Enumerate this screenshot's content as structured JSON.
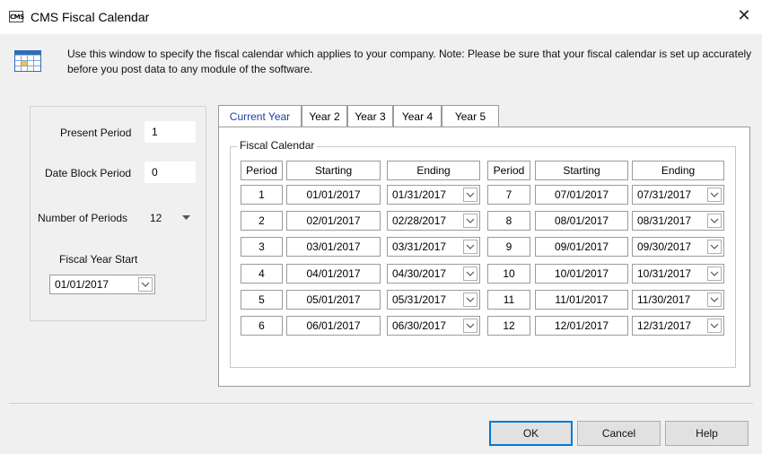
{
  "window": {
    "title": "CMS Fiscal Calendar",
    "app_icon_text": "CMS",
    "close_glyph": "✕"
  },
  "info": {
    "text": "Use this window to specify the fiscal calendar which applies to your company. Note: Please be sure that your fiscal calendar is set up accurately before you post data to any module of the software.",
    "icon": "calendar-grid-icon"
  },
  "left": {
    "present_period_label": "Present Period",
    "present_period_value": "1",
    "date_block_label": "Date Block Period",
    "date_block_value": "0",
    "num_periods_label": "Number of Periods",
    "num_periods_value": "12",
    "fy_start_label": "Fiscal Year Start",
    "fy_start_value": "01/01/2017"
  },
  "tabs": [
    "Current Year",
    "Year 2",
    "Year 3",
    "Year 4",
    "Year 5"
  ],
  "calendar": {
    "legend": "Fiscal Calendar",
    "headers": {
      "period": "Period",
      "starting": "Starting",
      "ending": "Ending"
    },
    "rows": [
      {
        "p1": "1",
        "s1": "01/01/2017",
        "e1": "01/31/2017",
        "p2": "7",
        "s2": "07/01/2017",
        "e2": "07/31/2017"
      },
      {
        "p1": "2",
        "s1": "02/01/2017",
        "e1": "02/28/2017",
        "p2": "8",
        "s2": "08/01/2017",
        "e2": "08/31/2017"
      },
      {
        "p1": "3",
        "s1": "03/01/2017",
        "e1": "03/31/2017",
        "p2": "9",
        "s2": "09/01/2017",
        "e2": "09/30/2017"
      },
      {
        "p1": "4",
        "s1": "04/01/2017",
        "e1": "04/30/2017",
        "p2": "10",
        "s2": "10/01/2017",
        "e2": "10/31/2017"
      },
      {
        "p1": "5",
        "s1": "05/01/2017",
        "e1": "05/31/2017",
        "p2": "11",
        "s2": "11/01/2017",
        "e2": "11/30/2017"
      },
      {
        "p1": "6",
        "s1": "06/01/2017",
        "e1": "06/30/2017",
        "p2": "12",
        "s2": "12/01/2017",
        "e2": "12/31/2017"
      }
    ]
  },
  "buttons": {
    "ok": "OK",
    "cancel": "Cancel",
    "help": "Help"
  },
  "colors": {
    "active_tab": "#1a44a8",
    "default_button_border": "#0078d7",
    "window_bg": "#f0f0f0"
  }
}
